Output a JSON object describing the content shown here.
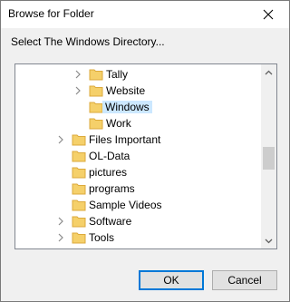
{
  "window": {
    "title": "Browse for Folder"
  },
  "prompt": "Select The Windows Directory...",
  "tree": {
    "items": [
      {
        "label": "Tally",
        "expandable": true,
        "selected": false
      },
      {
        "label": "Website",
        "expandable": true,
        "selected": false
      },
      {
        "label": "Windows",
        "expandable": false,
        "selected": true
      },
      {
        "label": "Work",
        "expandable": false,
        "selected": false
      },
      {
        "label": "Files Important",
        "expandable": true,
        "selected": false
      },
      {
        "label": "OL-Data",
        "expandable": false,
        "selected": false
      },
      {
        "label": "pictures",
        "expandable": false,
        "selected": false
      },
      {
        "label": "programs",
        "expandable": false,
        "selected": false
      },
      {
        "label": "Sample Videos",
        "expandable": false,
        "selected": false
      },
      {
        "label": "Software",
        "expandable": true,
        "selected": false
      },
      {
        "label": "Tools",
        "expandable": true,
        "selected": false
      }
    ]
  },
  "buttons": {
    "ok": "OK",
    "cancel": "Cancel"
  },
  "colors": {
    "folder": "#f5d06a",
    "folder_edge": "#dcaa3c",
    "selection": "#cce8ff",
    "default_button_border": "#0078d7"
  },
  "icons": {
    "close": "close-icon",
    "expand": "chevron-right-icon",
    "folder": "folder-icon",
    "scroll_up": "scroll-up-arrow-icon",
    "scroll_down": "scroll-down-arrow-icon"
  }
}
